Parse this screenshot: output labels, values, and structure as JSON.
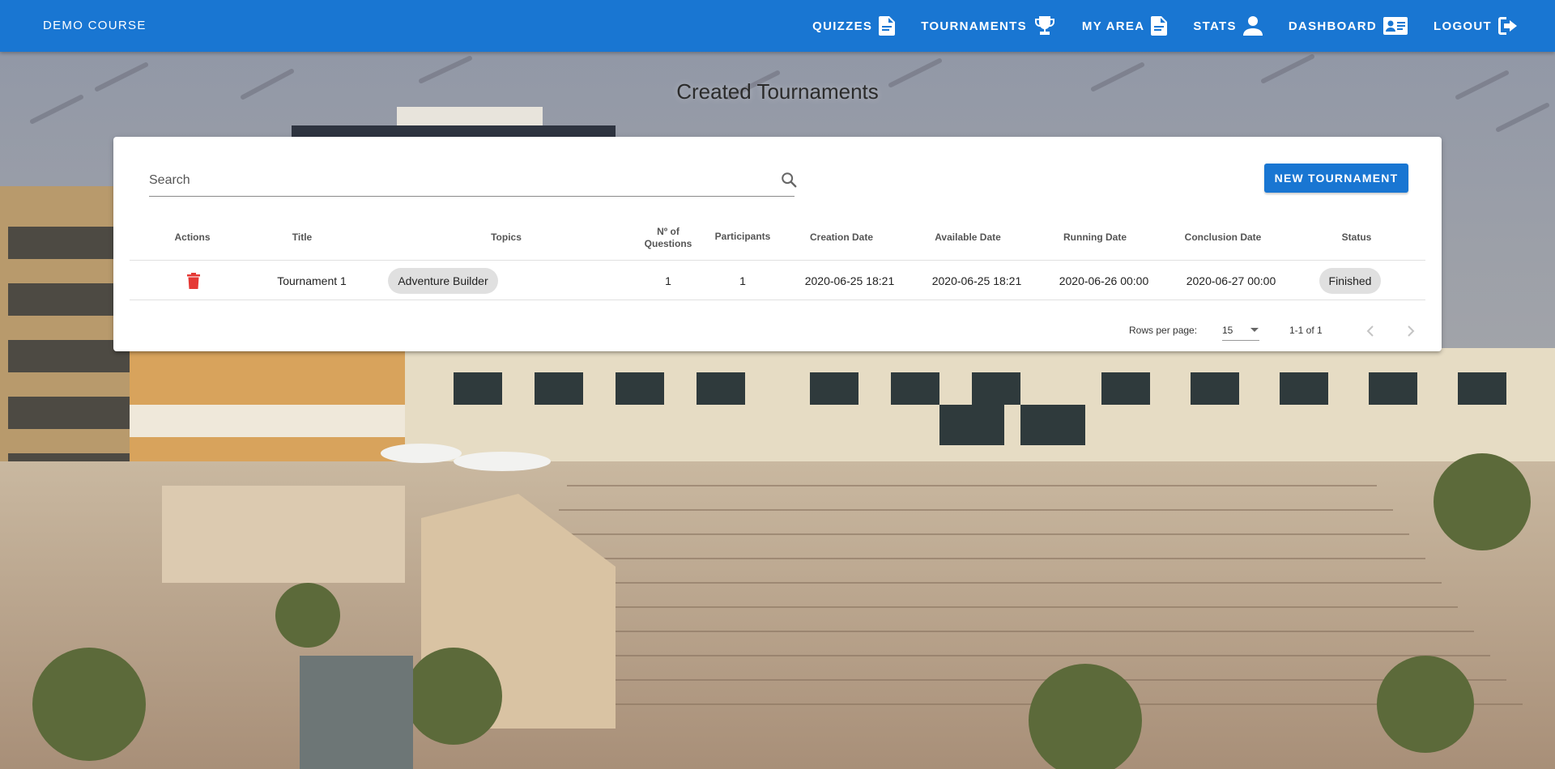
{
  "app": {
    "course_title": "DEMO COURSE"
  },
  "nav": {
    "items": [
      {
        "label": "QUIZZES",
        "icon": "file-document-icon"
      },
      {
        "label": "TOURNAMENTS",
        "icon": "trophy-icon"
      },
      {
        "label": "MY AREA",
        "icon": "file-document-icon"
      },
      {
        "label": "STATS",
        "icon": "account-icon"
      },
      {
        "label": "DASHBOARD",
        "icon": "id-card-icon"
      },
      {
        "label": "LOGOUT",
        "icon": "logout-icon"
      }
    ]
  },
  "page": {
    "title": "Created Tournaments"
  },
  "search": {
    "placeholder": "Search",
    "value": ""
  },
  "actions": {
    "new_tournament_label": "NEW TOURNAMENT"
  },
  "table": {
    "headers": {
      "actions": "Actions",
      "title": "Title",
      "topics": "Topics",
      "num_questions_line1": "Nº of",
      "num_questions_line2": "Questions",
      "participants": "Participants",
      "creation_date": "Creation Date",
      "available_date": "Available Date",
      "running_date": "Running Date",
      "conclusion_date": "Conclusion Date",
      "status": "Status"
    },
    "rows": [
      {
        "title": "Tournament 1",
        "topics": [
          "Adventure Builder"
        ],
        "num_questions": "1",
        "participants": "1",
        "creation_date": "2020-06-25 18:21",
        "available_date": "2020-06-25 18:21",
        "running_date": "2020-06-26 00:00",
        "conclusion_date": "2020-06-27 00:00",
        "status": "Finished"
      }
    ]
  },
  "pagination": {
    "rows_per_page_label": "Rows per page:",
    "rows_per_page_value": "15",
    "range_text": "1-1 of 1"
  },
  "colors": {
    "primary": "#1976d2",
    "delete_icon": "#e53935",
    "chip_bg": "#e0e0e0"
  }
}
